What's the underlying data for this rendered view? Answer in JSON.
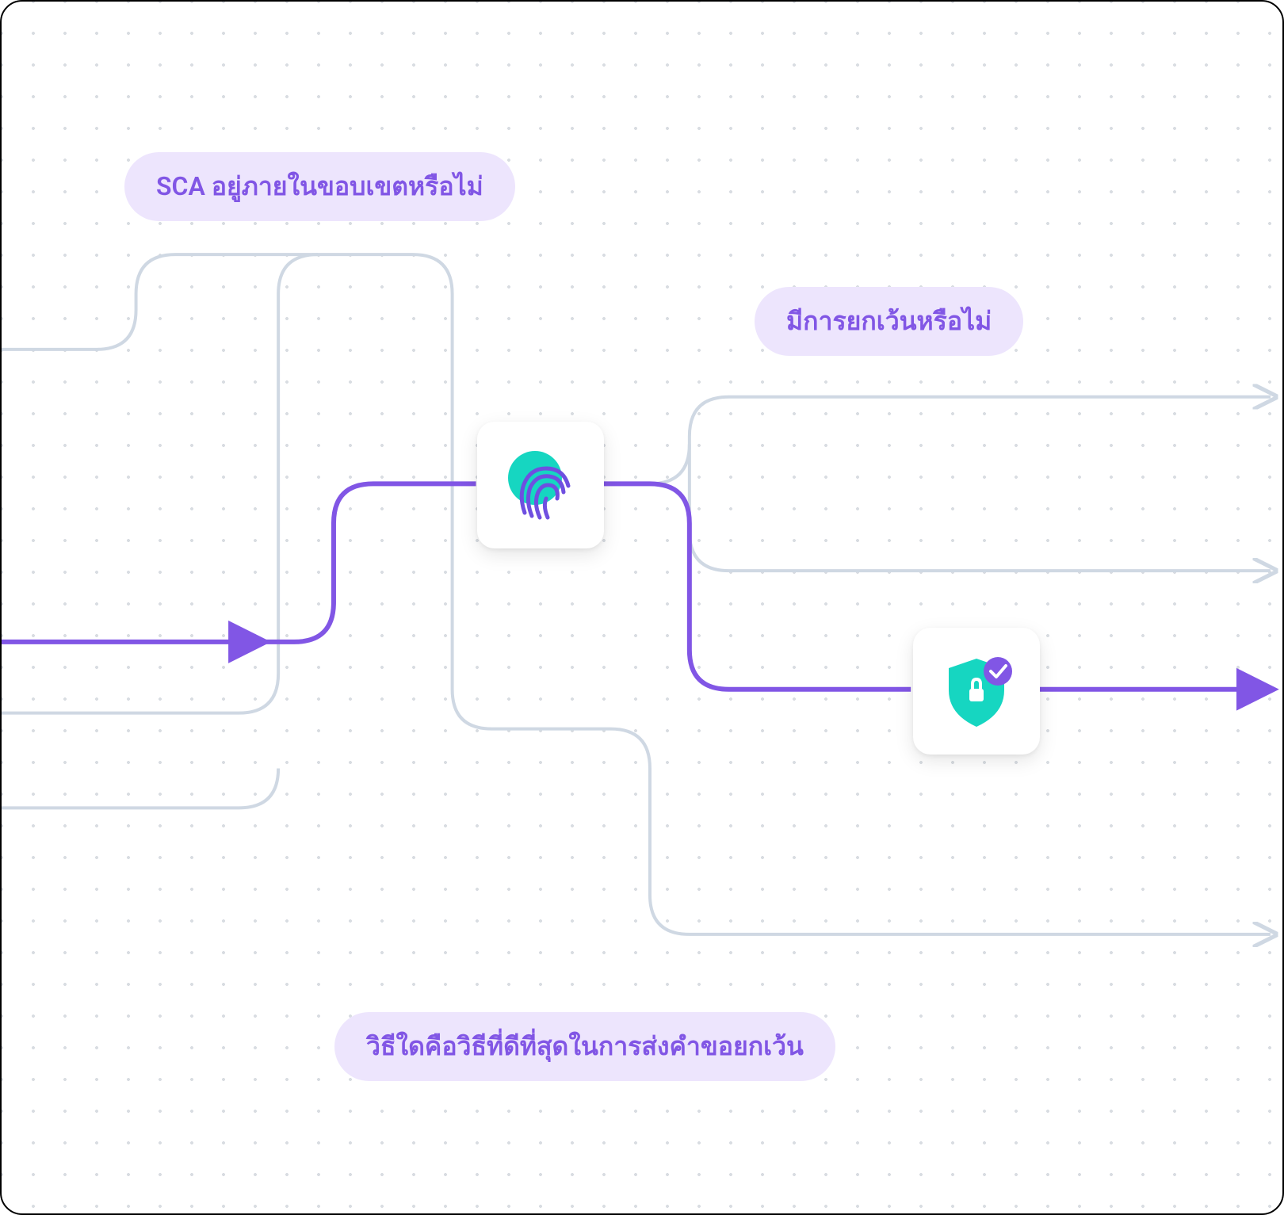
{
  "labels": {
    "top": "SCA อยู่ภายในขอบเขตหรือไม่",
    "right": "มีการยกเว้นหรือไม่",
    "bottom": "วิธีใดคือวิธีที่ดีที่สุดในการส่งคำขอยกเว้น"
  },
  "colors": {
    "pill_bg": "#ede5fd",
    "pill_text": "#8156e5",
    "flow_light": "#cfd8e3",
    "flow_purple": "#8156e5",
    "teal": "#16d6c1",
    "purple_fp": "#6f4fe0",
    "check_purple": "#8156e5"
  },
  "nodes": {
    "fingerprint": "fingerprint-icon",
    "shield": "shield-check-icon"
  }
}
